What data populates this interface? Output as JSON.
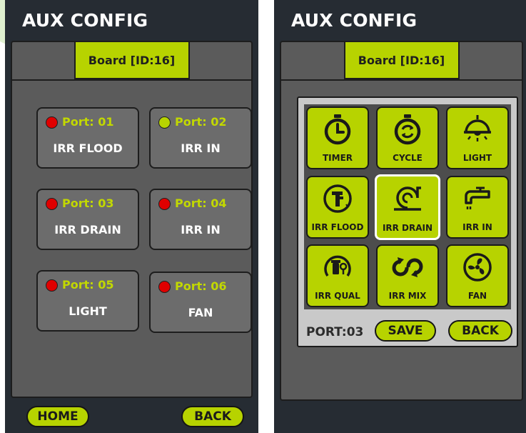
{
  "left_screen": {
    "title": "AUX CONFIG",
    "tab_label": "Board [ID:16]",
    "ports": [
      {
        "label": "Port: 01",
        "name": "IRR FLOOD",
        "status_color": "#e00000"
      },
      {
        "label": "Port: 02",
        "name": "IRR IN",
        "status_color": "#b7d300"
      },
      {
        "label": "Port: 03",
        "name": "IRR DRAIN",
        "status_color": "#e00000"
      },
      {
        "label": "Port: 04",
        "name": "IRR IN",
        "status_color": "#e00000"
      },
      {
        "label": "Port: 05",
        "name": "LIGHT",
        "status_color": "#e00000"
      },
      {
        "label": "Port: 06",
        "name": "FAN",
        "status_color": "#e00000"
      }
    ],
    "home_label": "HOME",
    "back_label": "BACK"
  },
  "right_screen": {
    "title": "AUX CONFIG",
    "tab_label": "Board [ID:16]",
    "tiles": [
      {
        "label": "TIMER",
        "icon": "stopwatch-icon"
      },
      {
        "label": "CYCLE",
        "icon": "cycle-stopwatch-icon"
      },
      {
        "label": "LIGHT",
        "icon": "lamp-icon"
      },
      {
        "label": "IRR FLOOD",
        "icon": "flood-icon"
      },
      {
        "label": "IRR DRAIN",
        "icon": "drain-icon"
      },
      {
        "label": "IRR IN",
        "icon": "faucet-icon"
      },
      {
        "label": "IRR QUAL",
        "icon": "quality-icon"
      },
      {
        "label": "IRR MIX",
        "icon": "mix-icon"
      },
      {
        "label": "FAN",
        "icon": "fan-icon"
      }
    ],
    "selected_tile": "IRR DRAIN",
    "port_label": "PORT:03",
    "save_label": "SAVE",
    "back_label": "BACK"
  },
  "colors": {
    "accent": "#b7d300",
    "screen_bg": "#262c33",
    "panel_bg": "#5b5b5b",
    "status_off": "#e00000",
    "status_on": "#b7d300"
  }
}
